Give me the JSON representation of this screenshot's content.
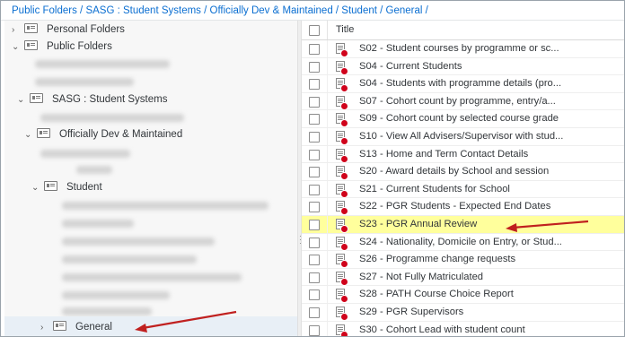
{
  "breadcrumb": "Public Folders / SASG : Student Systems / Officially Dev & Maintained / Student / General /",
  "tree": {
    "personal_folders": "Personal Folders",
    "public_folders": "Public Folders",
    "sasg": "SASG : Student Systems",
    "official": "Officially Dev & Maintained",
    "student": "Student",
    "general": "General",
    "expanded_glyph": "⌄",
    "collapsed_glyph": "›"
  },
  "table": {
    "header": "Title",
    "rows": [
      {
        "title": "S02 - Student courses by programme or sc..."
      },
      {
        "title": "S04 - Current Students"
      },
      {
        "title": "S04 - Students with programme details (pro..."
      },
      {
        "title": "S07 - Cohort count by programme, entry/a..."
      },
      {
        "title": "S09 - Cohort count by selected course grade"
      },
      {
        "title": "S10 - View All Advisers/Supervisor with stud..."
      },
      {
        "title": "S13 - Home and Term Contact Details"
      },
      {
        "title": "S20 - Award details by School and session"
      },
      {
        "title": "S21 - Current Students for School"
      },
      {
        "title": "S22 - PGR Students - Expected End Dates"
      },
      {
        "title": "S23 - PGR Annual Review"
      },
      {
        "title": "S24 - Nationality, Domicile on Entry, or Stud..."
      },
      {
        "title": "S26 - Programme change requests"
      },
      {
        "title": "S27 - Not Fully Matriculated"
      },
      {
        "title": "S28 - PATH Course Choice Report"
      },
      {
        "title": "S29 - PGR Supervisors"
      },
      {
        "title": "S30 - Cohort Lead with student count"
      }
    ],
    "highlighted_index": 10
  },
  "colors": {
    "highlight": "#ffff9c",
    "annotation_arrow": "#c0201f",
    "link": "#0a6ed1"
  }
}
